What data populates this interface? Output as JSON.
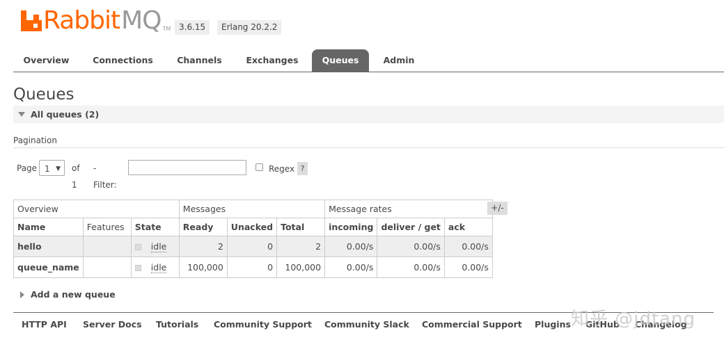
{
  "logo": {
    "rabbit": "Rabbit",
    "mq": "MQ",
    "tm": "TM"
  },
  "versions": {
    "rabbitmq": "3.6.15",
    "erlang": "Erlang 20.2.2"
  },
  "tabs": [
    {
      "label": "Overview"
    },
    {
      "label": "Connections"
    },
    {
      "label": "Channels"
    },
    {
      "label": "Exchanges"
    },
    {
      "label": "Queues",
      "active": true
    },
    {
      "label": "Admin"
    }
  ],
  "page_title": "Queues",
  "section": {
    "label": "All queues (2)"
  },
  "pagination": {
    "label": "Pagination",
    "page_label": "Page",
    "page_value": "1",
    "of_label": "of 1",
    "filter_label": "- Filter:",
    "filter_value": "",
    "regex_label": "Regex",
    "help_label": "?"
  },
  "table": {
    "groups": [
      "Overview",
      "Messages",
      "Message rates"
    ],
    "columns_toggle": "+/-",
    "headers": [
      "Name",
      "Features",
      "State",
      "Ready",
      "Unacked",
      "Total",
      "incoming",
      "deliver / get",
      "ack"
    ],
    "rows": [
      {
        "name": "hello",
        "features": "",
        "state": "idle",
        "ready": "2",
        "unacked": "0",
        "total": "2",
        "incoming": "0.00/s",
        "deliver_get": "0.00/s",
        "ack": "0.00/s"
      },
      {
        "name": "queue_name",
        "features": "",
        "state": "idle",
        "ready": "100,000",
        "unacked": "0",
        "total": "100,000",
        "incoming": "0.00/s",
        "deliver_get": "0.00/s",
        "ack": "0.00/s"
      }
    ]
  },
  "add_queue": "Add a new queue",
  "footer": [
    "HTTP API",
    "Server Docs",
    "Tutorials",
    "Community Support",
    "Community Slack",
    "Commercial Support",
    "Plugins",
    "GitHub",
    "Changelog"
  ],
  "watermark": "知乎 @jdtang",
  "colors": {
    "brand": "#ff6600",
    "tab_active": "#666666",
    "text": "#484848"
  }
}
